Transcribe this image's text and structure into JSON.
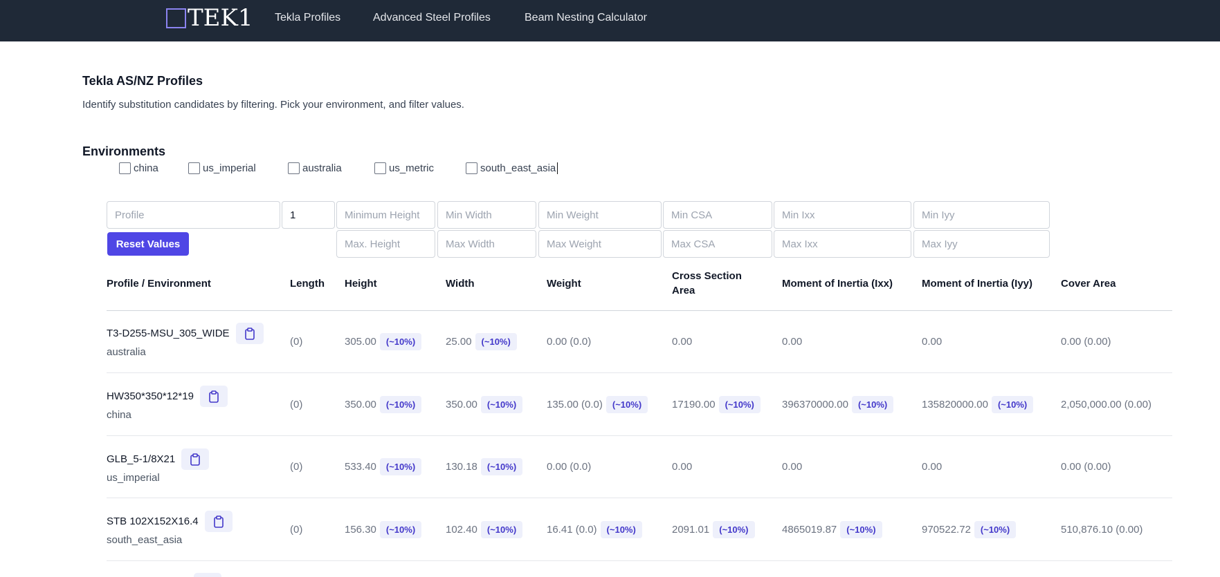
{
  "header": {
    "logo_text": "TEK1",
    "nav": [
      "Tekla Profiles",
      "Advanced Steel Profiles",
      "Beam Nesting Calculator"
    ]
  },
  "intro": {
    "title": "Tekla AS/NZ Profiles",
    "description": "Identify substitution candidates by filtering. Pick your environment, and filter values."
  },
  "environments": {
    "title": "Environments",
    "options": [
      "china",
      "us_imperial",
      "australia",
      "us_metric",
      "south_east_asia"
    ]
  },
  "filters": {
    "profile_placeholder": "Profile",
    "length_value": "1",
    "min_height": "Minimum Height",
    "max_height": "Max. Height",
    "min_width": "Min Width",
    "max_width": "Max Width",
    "min_weight": "Min Weight",
    "max_weight": "Max Weight",
    "min_csa": "Min CSA",
    "max_csa": "Max CSA",
    "min_ixx": "Min Ixx",
    "max_ixx": "Max Ixx",
    "min_iyy": "Min Iyy",
    "max_iyy": "Max Iyy",
    "reset_label": "Reset Values"
  },
  "table": {
    "headers": {
      "profile": "Profile / Environment",
      "length": "Length",
      "height": "Height",
      "width": "Width",
      "weight": "Weight",
      "csa_line1": "Cross Section",
      "csa_line2": "Area",
      "ixx": "Moment of Inertia (Ixx)",
      "iyy": "Moment of Inertia (Iyy)",
      "cover": "Cover Area"
    },
    "badge": "(~10%)",
    "rows": [
      {
        "name": "T3-D255-MSU_305_WIDE",
        "env": "australia",
        "length": "(0)",
        "height": "305.00",
        "width": "25.00",
        "weight": "0.00 (0.0)",
        "csa": "0.00",
        "ixx": "0.00",
        "iyy": "0.00",
        "cover": "0.00 (0.00)"
      },
      {
        "name": "HW350*350*12*19",
        "env": "china",
        "length": "(0)",
        "height": "350.00",
        "width": "350.00",
        "weight": "135.00 (0.0)",
        "csa": "17190.00",
        "ixx": "396370000.00",
        "iyy": "135820000.00",
        "cover": "2,050,000.00 (0.00)"
      },
      {
        "name": "GLB_5-1/8X21",
        "env": "us_imperial",
        "length": "(0)",
        "height": "533.40",
        "width": "130.18",
        "weight": "0.00 (0.0)",
        "csa": "0.00",
        "ixx": "0.00",
        "iyy": "0.00",
        "cover": "0.00 (0.00)"
      },
      {
        "name": "STB 102X152X16.4",
        "env": "south_east_asia",
        "length": "(0)",
        "height": "156.30",
        "width": "102.40",
        "weight": "16.41 (0.0)",
        "csa": "2091.01",
        "ixx": "4865019.87",
        "iyy": "970522.72",
        "cover": "510,876.10 (0.00)"
      }
    ]
  }
}
